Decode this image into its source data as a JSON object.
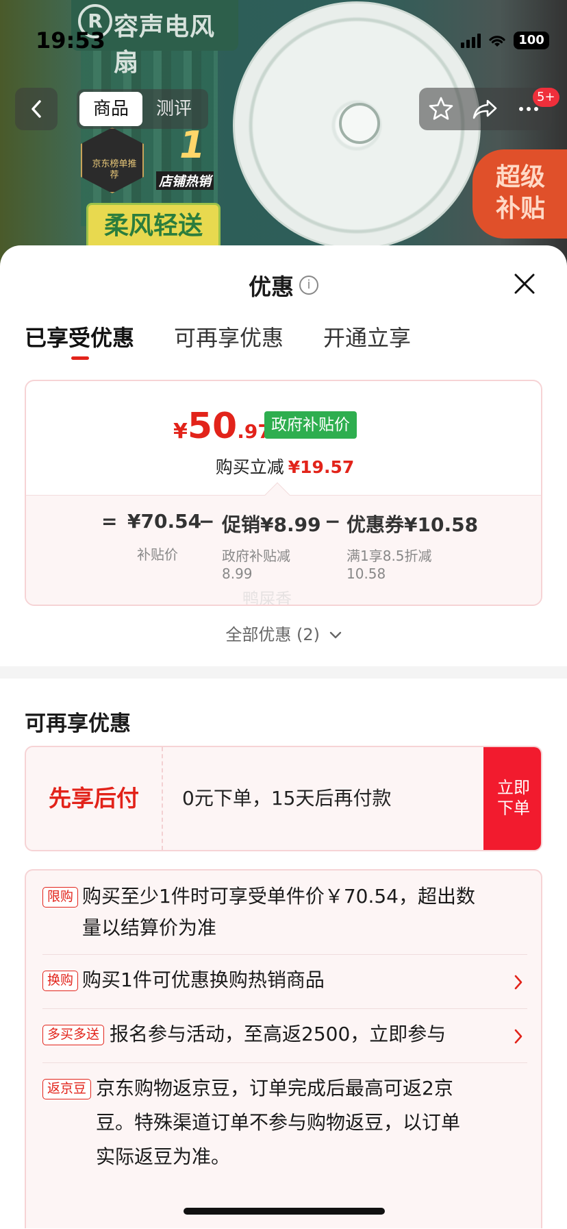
{
  "status_bar": {
    "time": "19:53",
    "battery": "100"
  },
  "hero": {
    "brand_name": "容声电风扇",
    "ranking_badge": "京东榜单推荐",
    "top_badge_num": "1",
    "top_badge_label": "店铺热销",
    "slogan": "柔风轻送",
    "super_subsidy": "超级补贴"
  },
  "nav": {
    "tabs": [
      {
        "label": "商品",
        "active": true
      },
      {
        "label": "测评",
        "active": false
      }
    ],
    "badge": "5+"
  },
  "sheet": {
    "title": "优惠",
    "tabs": [
      {
        "label": "已享受优惠",
        "active": true
      },
      {
        "label": "可再享优惠",
        "active": false
      },
      {
        "label": "开通立享",
        "active": false
      }
    ]
  },
  "price_card": {
    "currency": "¥",
    "price_int": "50",
    "price_dec": ".97",
    "gov_badge": "政府补贴价",
    "save_label": "购买立减",
    "save_amount": "¥19.57",
    "equals": "=",
    "subsidy_price": "¥70.54",
    "subsidy_price_label": "补贴价",
    "minus1": "−",
    "promo": "促销¥8.99",
    "promo_label_1": "政府补贴减",
    "promo_label_2": "8.99",
    "minus2": "−",
    "coupon": "优惠券¥10.58",
    "coupon_label_1": "满1享8.5折减",
    "coupon_label_2": "10.58",
    "watermark": "鸭屎香"
  },
  "all_offers": "全部优惠 (2)",
  "section_title": "可再享优惠",
  "pay_later": {
    "name": "先享后付",
    "desc": "0元下单，15天后再付款",
    "button_line1": "立即",
    "button_line2": "下单"
  },
  "promotions": [
    {
      "tag": "限购",
      "line1": "购买至少1件时可享受单件价￥70.54，超出数",
      "line2": "量以结算价为准",
      "has_arrow": false
    },
    {
      "tag": "换购",
      "line1": "购买1件可优惠换购热销商品",
      "has_arrow": true
    },
    {
      "tag": "多买多送",
      "line1": "报名参与活动，至高返2500，立即参与",
      "has_arrow": true
    },
    {
      "tag": "返京豆",
      "line1": "京东购物返京豆，订单完成后最高可返2京",
      "line2": "豆。特殊渠道订单不参与购物返豆，以订单",
      "line3": "实际返豆为准。",
      "has_arrow": false
    }
  ],
  "colors": {
    "accent_red": "#e2231a",
    "gov_green": "#2eae4f",
    "button_red": "#f21b2e"
  }
}
